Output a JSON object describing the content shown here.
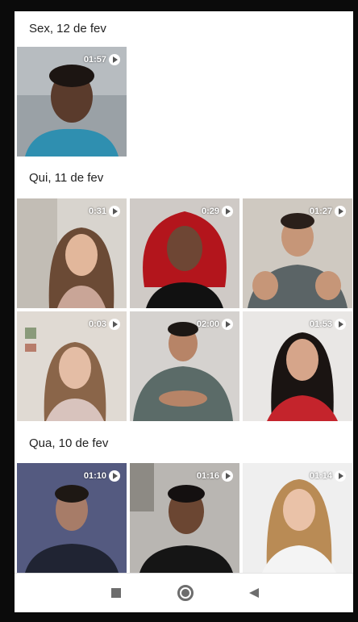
{
  "gallery": {
    "sections": [
      {
        "date": "Sex, 12 de fev",
        "videos": [
          {
            "duration": "01:57"
          }
        ]
      },
      {
        "date": "Qui, 11 de fev",
        "videos": [
          {
            "duration": "0:31"
          },
          {
            "duration": "0:29"
          },
          {
            "duration": "01:27"
          },
          {
            "duration": "0:03"
          },
          {
            "duration": "02:00"
          },
          {
            "duration": "01:53"
          }
        ]
      },
      {
        "date": "Qua, 10 de fev",
        "videos": [
          {
            "duration": "01:10"
          },
          {
            "duration": "01:16"
          },
          {
            "duration": "01:14"
          }
        ]
      }
    ]
  },
  "navbar": {
    "icons": [
      "recents-icon",
      "home-icon",
      "back-icon"
    ]
  }
}
